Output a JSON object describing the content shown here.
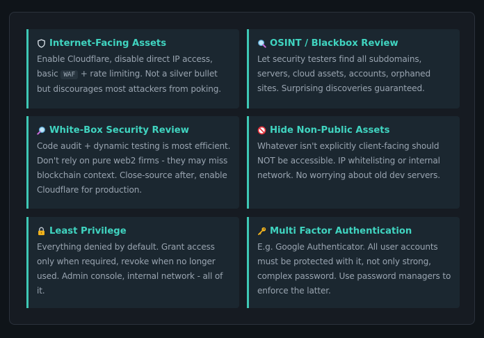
{
  "cards": [
    {
      "title": "Internet-Facing Assets",
      "icon": "shield-icon",
      "body_before": "Enable Cloudflare, disable direct IP access, basic ",
      "code": "WAF",
      "body_after": " + rate limiting. Not a silver bullet but discourages most attackers from poking."
    },
    {
      "title": "OSINT / Blackbox Review",
      "icon": "magnifier-icon",
      "body": "Let security testers find all subdomains, servers, cloud assets, accounts, orphaned sites. Surprising discoveries guaranteed."
    },
    {
      "title": "White-Box Security Review",
      "icon": "magnifier-right-icon",
      "body": "Code audit + dynamic testing is most efficient. Don't rely on pure web2 firms - they may miss blockchain context. Close-source after, enable Cloudflare for production."
    },
    {
      "title": "Hide Non-Public Assets",
      "icon": "prohibited-icon",
      "body": "Whatever isn't explicitly client-facing should NOT be accessible. IP whitelisting or internal network. No worrying about old dev servers."
    },
    {
      "title": "Least Privilege",
      "icon": "lock-icon",
      "body": "Everything denied by default. Grant access only when required, revoke when no longer used. Admin console, internal network - all of it."
    },
    {
      "title": "Multi Factor Authentication",
      "icon": "key-icon",
      "body": "E.g. Google Authenticator. All user accounts must be protected with it, not only strong, complex password. Use password managers to enforce the latter."
    }
  ],
  "colors": {
    "accent": "#40d4c0",
    "card_background": "#1b2730",
    "panel_background": "#161b22",
    "page_background": "#0f1419",
    "body_text": "#99a4b0"
  }
}
